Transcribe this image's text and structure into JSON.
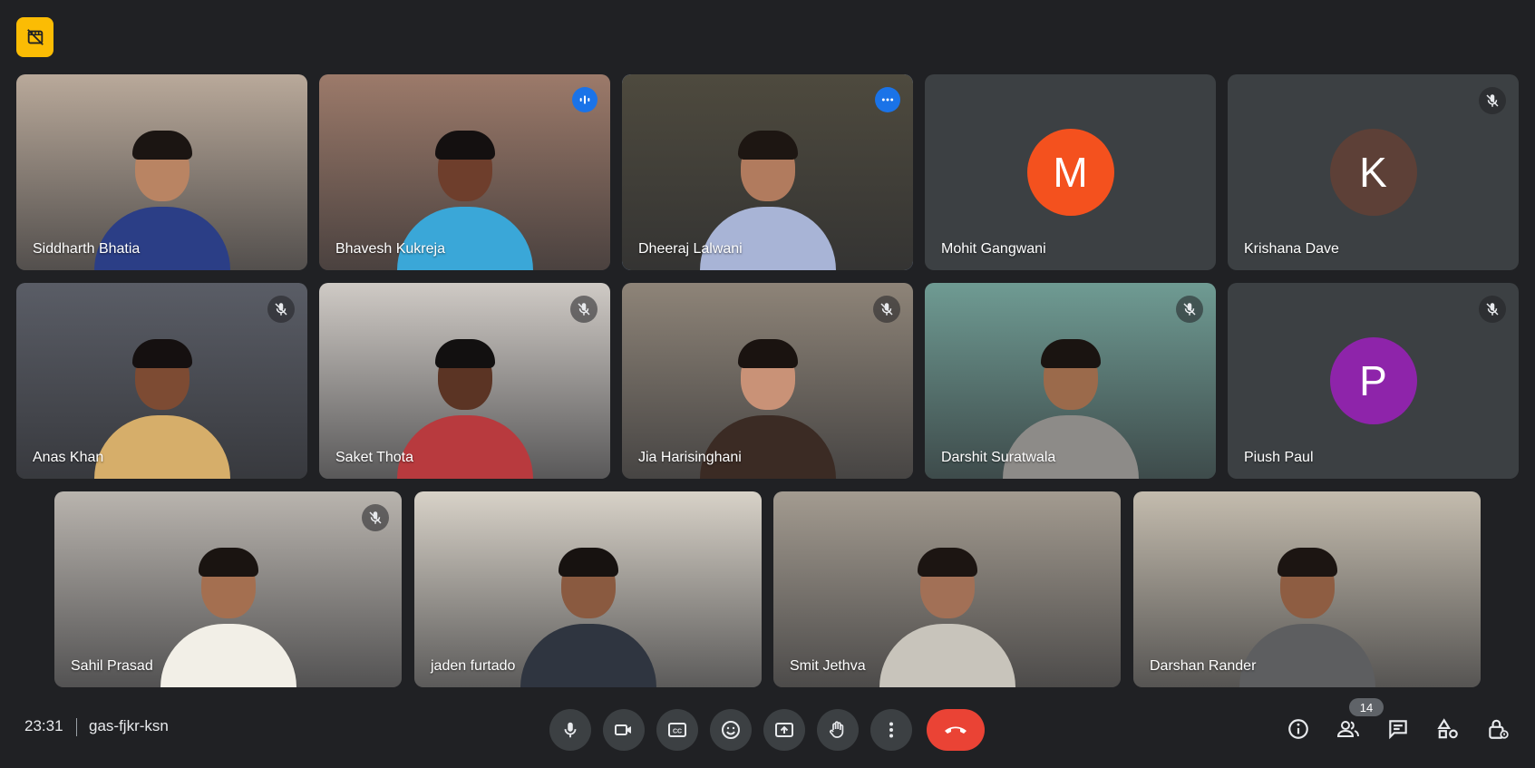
{
  "meeting": {
    "time": "23:31",
    "code": "gas-fjkr-ksn",
    "participant_count": "14"
  },
  "participants": [
    {
      "name": "Siddharth Bhatia",
      "state": "video",
      "bg": "#b9a99a",
      "shirt": "#2b3e86",
      "skin": "#b98463",
      "hair": "#1b1512"
    },
    {
      "name": "Bhavesh Kukreja",
      "state": "video-speaking",
      "bg": "#9c7a6a",
      "shirt": "#3aa7d8",
      "skin": "#6e3e2c",
      "hair": "#141010"
    },
    {
      "name": "Dheeraj Lalwani",
      "state": "video-active",
      "bg": "#4e4a3e",
      "shirt": "#a8b4d6",
      "skin": "#b17b5e",
      "hair": "#1d1612"
    },
    {
      "name": "Mohit Gangwani",
      "state": "avatar",
      "initial": "M",
      "avatar_color": "#f4511e"
    },
    {
      "name": "Krishana Dave",
      "state": "avatar-muted",
      "initial": "K",
      "avatar_color": "#5d4037"
    },
    {
      "name": "Anas Khan",
      "state": "video-muted",
      "bg": "#5a5d66",
      "shirt": "#d6ae6a",
      "skin": "#7d4b33",
      "hair": "#151010"
    },
    {
      "name": "Saket Thota",
      "state": "video-muted",
      "bg": "#cfcac5",
      "shirt": "#b83a3e",
      "skin": "#5b3424",
      "hair": "#121010"
    },
    {
      "name": "Jia Harisinghani",
      "state": "video-muted",
      "bg": "#8e8478",
      "shirt": "#3b2b24",
      "skin": "#c99277",
      "hair": "#1a1310"
    },
    {
      "name": "Darshit Suratwala",
      "state": "video-muted",
      "bg": "#6f9b93",
      "shirt": "#8d8b88",
      "skin": "#9b6a4b",
      "hair": "#1a1411"
    },
    {
      "name": "Piush Paul",
      "state": "avatar-muted",
      "initial": "P",
      "avatar_color": "#8e24aa"
    },
    {
      "name": "Sahil Prasad",
      "state": "video-muted",
      "bg": "#b9b4ae",
      "shirt": "#f2efe7",
      "skin": "#a46f50",
      "hair": "#1a1411"
    },
    {
      "name": "jaden furtado",
      "state": "video",
      "bg": "#d8d2c8",
      "shirt": "#2f3540",
      "skin": "#8a5a40",
      "hair": "#171210"
    },
    {
      "name": "Smit Jethva",
      "state": "video",
      "bg": "#a39b90",
      "shirt": "#c8c4bb",
      "skin": "#a27056",
      "hair": "#1c1512"
    },
    {
      "name": "Darshan Rander",
      "state": "video",
      "bg": "#c4bcae",
      "shirt": "#5d5e60",
      "skin": "#8e5d42",
      "hair": "#1c1512"
    }
  ],
  "controls": {
    "buttons": [
      "mic-icon",
      "camera-icon",
      "captions-icon",
      "emoji-icon",
      "present-icon",
      "raise-hand-icon",
      "more-options-icon",
      "leave-call-icon"
    ],
    "right": [
      "info-icon",
      "people-icon",
      "chat-icon",
      "activities-icon",
      "host-controls-icon"
    ]
  },
  "colors": {
    "background": "#202124",
    "tile": "#3c4043",
    "accent": "#8ab4f8",
    "speaking": "#1a73e8",
    "leave": "#ea4335",
    "badge": "#fbbc04"
  }
}
